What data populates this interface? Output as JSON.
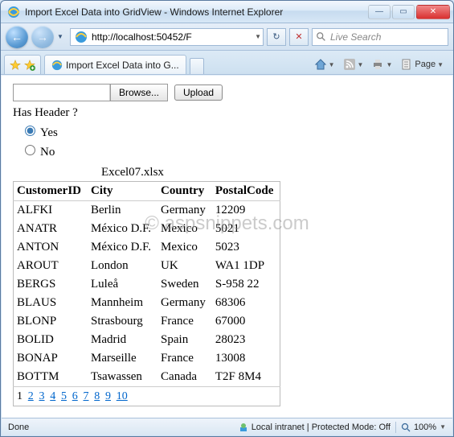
{
  "window": {
    "title": "Import Excel Data into GridView - Windows Internet Explorer",
    "minimize": "—",
    "maximize": "▭",
    "close": "✕"
  },
  "nav": {
    "back": "←",
    "forward": "→",
    "url": "http://localhost:50452/F",
    "refresh": "↻",
    "stop": "✕",
    "search_placeholder": "Live Search"
  },
  "tabs": {
    "active_label": "Import Excel Data into G..."
  },
  "commands": {
    "page_label": "Page"
  },
  "form": {
    "browse_label": "Browse...",
    "upload_label": "Upload",
    "question": "Has Header ?",
    "opt_yes": "Yes",
    "opt_no": "No"
  },
  "grid": {
    "caption": "Excel07.xlsx",
    "headers": [
      "CustomerID",
      "City",
      "Country",
      "PostalCode"
    ],
    "rows": [
      [
        "ALFKI",
        "Berlin",
        "Germany",
        "12209"
      ],
      [
        "ANATR",
        "México D.F.",
        "Mexico",
        "5021"
      ],
      [
        "ANTON",
        "México D.F.",
        "Mexico",
        "5023"
      ],
      [
        "AROUT",
        "London",
        "UK",
        "WA1 1DP"
      ],
      [
        "BERGS",
        "Luleå",
        "Sweden",
        "S-958 22"
      ],
      [
        "BLAUS",
        "Mannheim",
        "Germany",
        "68306"
      ],
      [
        "BLONP",
        "Strasbourg",
        "France",
        "67000"
      ],
      [
        "BOLID",
        "Madrid",
        "Spain",
        "28023"
      ],
      [
        "BONAP",
        "Marseille",
        "France",
        "13008"
      ],
      [
        "BOTTM",
        "Tsawassen",
        "Canada",
        "T2F 8M4"
      ]
    ],
    "pager": {
      "current": 1,
      "pages": [
        "1",
        "2",
        "3",
        "4",
        "5",
        "6",
        "7",
        "8",
        "9",
        "10"
      ]
    }
  },
  "watermark": "© aspsnippets.com",
  "status": {
    "left": "Done",
    "zone": "Local intranet | Protected Mode: Off",
    "zoom": "100%"
  }
}
